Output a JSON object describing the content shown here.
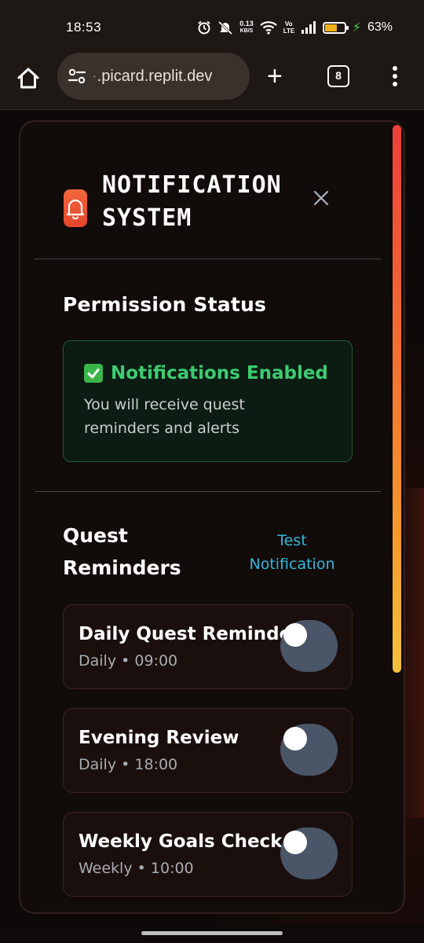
{
  "status_bar": {
    "time": "18:53",
    "net_speed_value": "0.13",
    "net_speed_unit": "KB/S",
    "volte": "Vo LTE",
    "battery_percent": "63%",
    "battery_level": 0.63,
    "battery_color": "#f2b019"
  },
  "browser": {
    "url_faded": "·",
    "url": ".picard.replit.dev",
    "tab_count": "8",
    "new_tab_glyph": "+"
  },
  "panel": {
    "title_line1": "NOTIFICATION",
    "title_line2": "SYSTEM",
    "accent": "#f05a3a"
  },
  "permission": {
    "heading": "Permission Status",
    "status": "Notifications Enabled",
    "description": "You will receive quest reminders and alerts",
    "status_color": "#3ecb72"
  },
  "reminders": {
    "heading_line1": "Quest",
    "heading_line2": "Reminders",
    "test_line1": "Test",
    "test_line2": "Notification",
    "items": [
      {
        "name": "Daily Quest Reminder",
        "frequency": "Daily",
        "sep": "•",
        "time": "09:00",
        "enabled": false
      },
      {
        "name": "Evening Review",
        "frequency": "Daily",
        "sep": "•",
        "time": "18:00",
        "enabled": false
      },
      {
        "name": "Weekly Goals Check",
        "frequency": "Weekly",
        "sep": "•",
        "time": "10:00",
        "enabled": false
      }
    ]
  }
}
